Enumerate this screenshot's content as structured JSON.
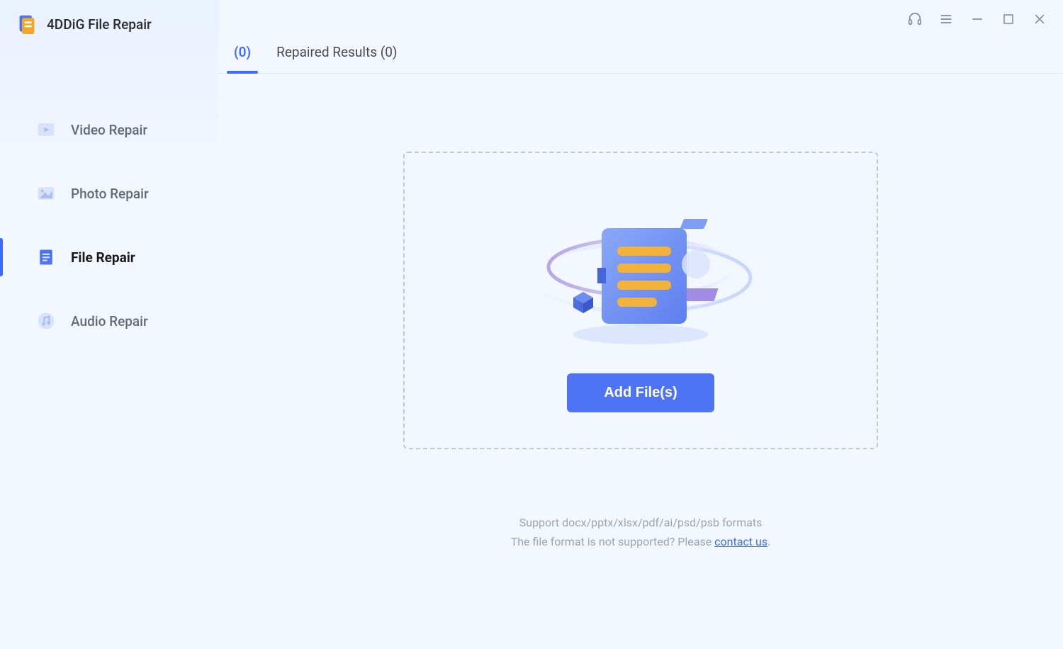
{
  "app": {
    "title": "4DDiG File Repair"
  },
  "sidebar": {
    "items": [
      {
        "id": "video",
        "label": "Video Repair",
        "active": false
      },
      {
        "id": "photo",
        "label": "Photo Repair",
        "active": false
      },
      {
        "id": "file",
        "label": "File Repair",
        "active": true
      },
      {
        "id": "audio",
        "label": "Audio Repair",
        "active": false
      }
    ]
  },
  "tabs": {
    "items": [
      {
        "id": "pending",
        "label": "(0)",
        "active": true
      },
      {
        "id": "repaired",
        "label": "Repaired Results (0)",
        "active": false
      }
    ]
  },
  "main": {
    "add_button": "Add File(s)",
    "support_line1": "Support docx/pptx/xlsx/pdf/ai/psd/psb formats",
    "support_line2_prefix": "The file format is not supported? Please ",
    "contact_link": "contact us",
    "support_line2_suffix": "."
  }
}
